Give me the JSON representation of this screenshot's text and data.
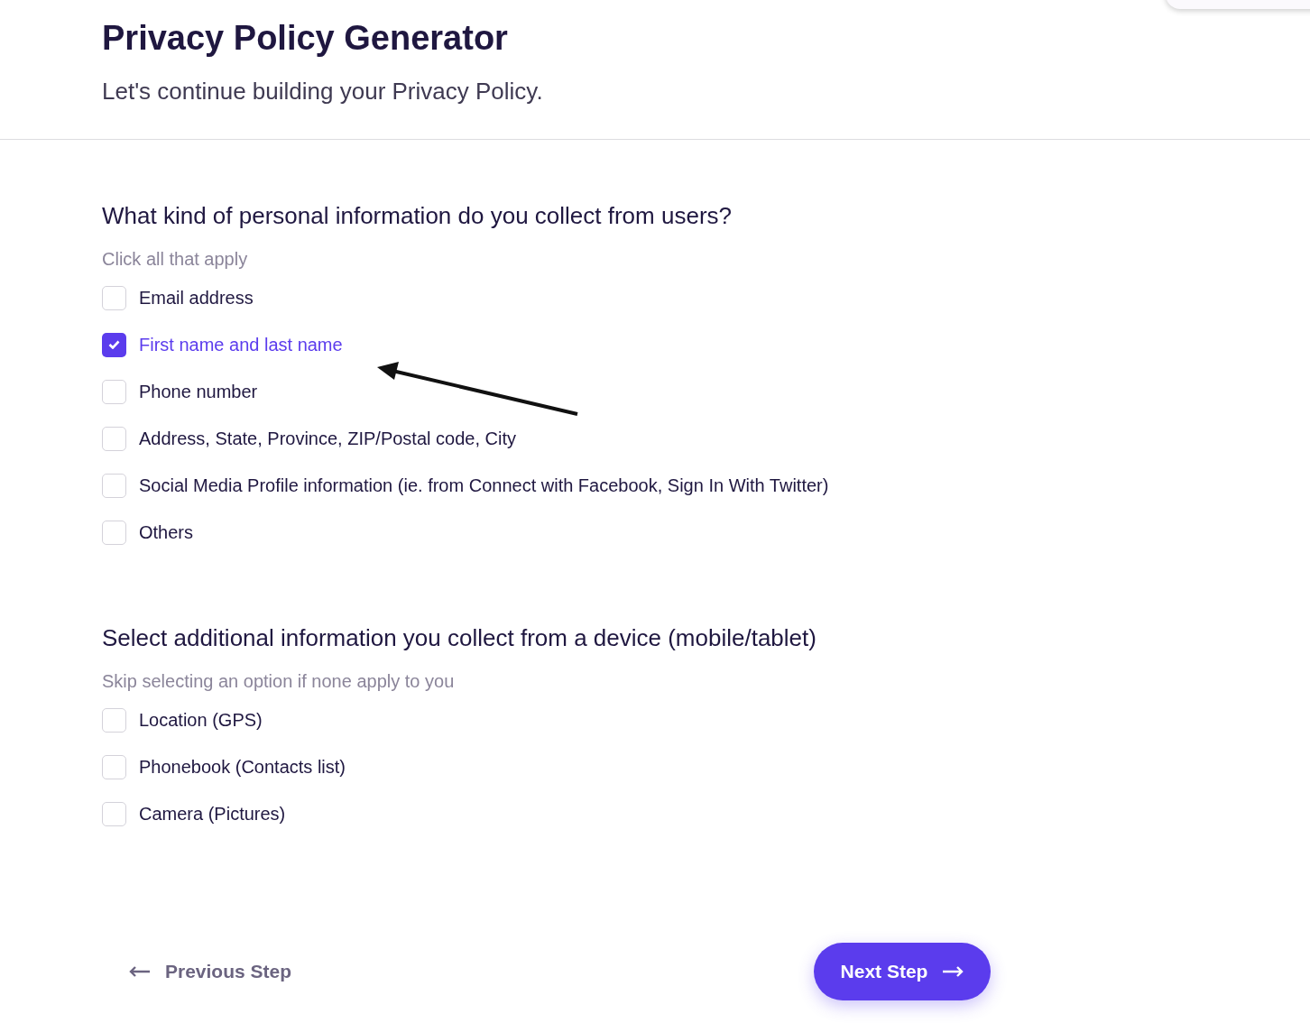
{
  "header": {
    "title": "Privacy Policy Generator",
    "subtitle": "Let's continue building your Privacy Policy."
  },
  "sections": [
    {
      "question": "What kind of personal information do you collect from users?",
      "hint": "Click all that apply",
      "options": [
        {
          "label": "Email address",
          "checked": false
        },
        {
          "label": "First name and last name",
          "checked": true
        },
        {
          "label": "Phone number",
          "checked": false
        },
        {
          "label": "Address, State, Province, ZIP/Postal code, City",
          "checked": false
        },
        {
          "label": "Social Media Profile information (ie. from Connect with Facebook, Sign In With Twitter)",
          "checked": false
        },
        {
          "label": "Others",
          "checked": false
        }
      ]
    },
    {
      "question": "Select additional information you collect from a device (mobile/tablet)",
      "hint": "Skip selecting an option if none apply to you",
      "options": [
        {
          "label": "Location (GPS)",
          "checked": false
        },
        {
          "label": "Phonebook (Contacts list)",
          "checked": false
        },
        {
          "label": "Camera (Pictures)",
          "checked": false
        }
      ]
    }
  ],
  "navigation": {
    "previous": "Previous Step",
    "next": "Next Step"
  }
}
